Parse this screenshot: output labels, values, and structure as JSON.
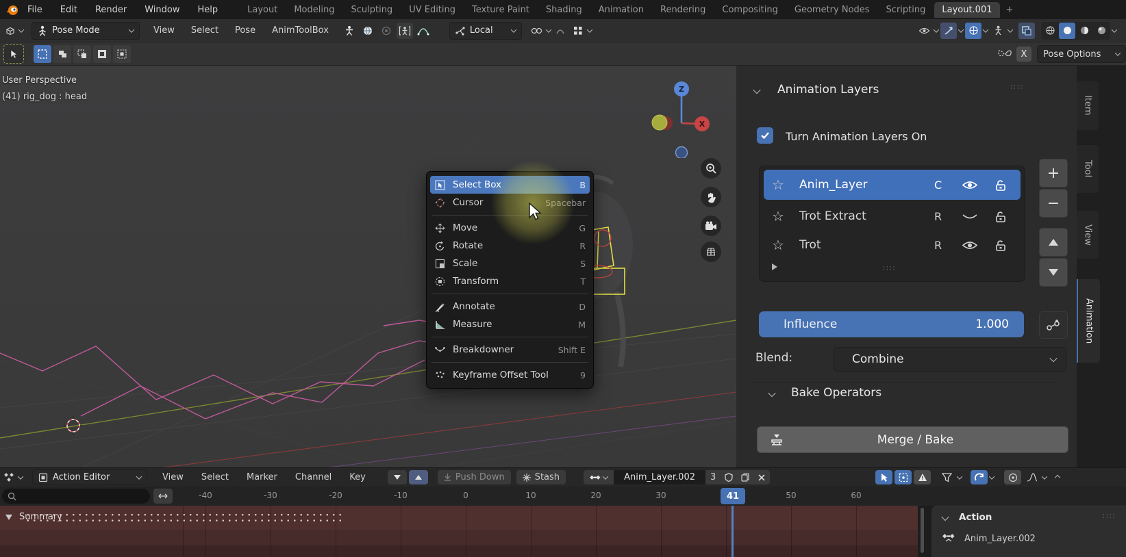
{
  "colors": {
    "accent": "#4772b3",
    "selection": "#4b78bd",
    "keys_area": "#4f302e",
    "viewport_bg": "#3c3c3d"
  },
  "topbar": {
    "menus": [
      "File",
      "Edit",
      "Render",
      "Window",
      "Help"
    ],
    "workspaces": [
      "Layout",
      "Modeling",
      "Sculpting",
      "UV Editing",
      "Texture Paint",
      "Shading",
      "Animation",
      "Rendering",
      "Compositing",
      "Geometry Nodes",
      "Scripting",
      "Layout.001"
    ],
    "active_workspace": "Layout.001",
    "new_workspace_label": "+"
  },
  "viewport_header": {
    "mode_label": "Pose Mode",
    "menus": [
      "View",
      "Select",
      "Pose",
      "AnimToolBox"
    ],
    "orientation_label": "Local"
  },
  "tool_header": {
    "mirror_label": "X",
    "pose_options_label": "Pose Options"
  },
  "viewport": {
    "overlay_line1": "User Perspective",
    "overlay_line2": "(41) rig_dog : head",
    "gizmo": {
      "z_label": "Z",
      "x_label": "X"
    }
  },
  "context_menu": {
    "items": [
      {
        "label": "Select Box",
        "shortcut": "B"
      },
      {
        "label": "Cursor",
        "shortcut": "Spacebar"
      },
      {
        "label": "Move",
        "shortcut": "G"
      },
      {
        "label": "Rotate",
        "shortcut": "R"
      },
      {
        "label": "Scale",
        "shortcut": "S"
      },
      {
        "label": "Transform",
        "shortcut": "T"
      },
      {
        "label": "Annotate",
        "shortcut": "D"
      },
      {
        "label": "Measure",
        "shortcut": "M"
      },
      {
        "label": "Breakdowner",
        "shortcut": "Shift E"
      },
      {
        "label": "Keyframe Offset Tool",
        "shortcut": "9"
      }
    ]
  },
  "sidebar": {
    "tabs": [
      "Item",
      "Tool",
      "View",
      "Animation"
    ],
    "active_tab": "Animation",
    "animation_layers_title": "Animation Layers",
    "turn_on_label": "Turn Animation Layers On",
    "layers": [
      {
        "name": "Anim_Layer",
        "tag": "C",
        "visibility": "eye-open",
        "lock": "unlocked",
        "selected": true
      },
      {
        "name": "Trot Extract",
        "tag": "R",
        "visibility": "eye-closed",
        "lock": "unlocked",
        "selected": false
      },
      {
        "name": "Trot",
        "tag": "R",
        "visibility": "eye-open",
        "lock": "unlocked",
        "selected": false
      }
    ],
    "influence": {
      "label": "Influence",
      "value": "1.000"
    },
    "blend": {
      "label": "Blend:",
      "value": "Combine"
    },
    "bake_operators_title": "Bake Operators",
    "merge_bake_label": "Merge / Bake"
  },
  "dopesheet": {
    "editor_selector": "Action Editor",
    "menus": [
      "View",
      "Select",
      "Marker",
      "Channel",
      "Key"
    ],
    "push_down_label": "Push Down",
    "stash_label": "Stash",
    "action_name": "Anim_Layer.002",
    "action_users": "3",
    "ruler_ticks": [
      "-40",
      "-30",
      "-20",
      "-10",
      "0",
      "10",
      "20",
      "30",
      "50",
      "60"
    ],
    "current_frame": "41",
    "summary_label": "Summary",
    "action_panel": {
      "title": "Action",
      "item_name": "Anim_Layer.002"
    }
  }
}
